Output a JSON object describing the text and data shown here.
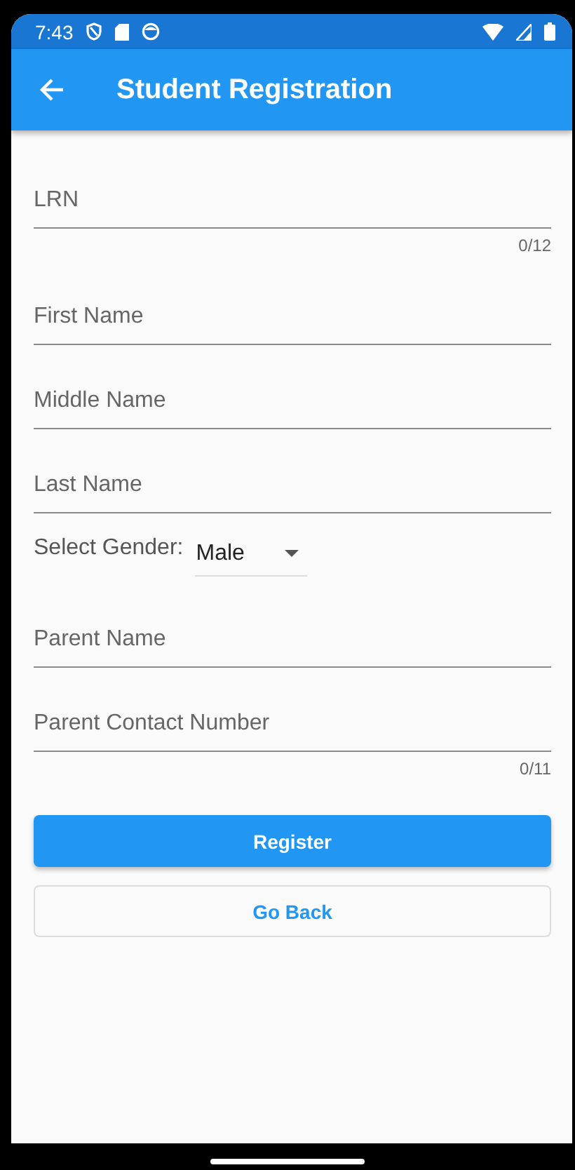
{
  "status_bar": {
    "time": "7:43"
  },
  "app_bar": {
    "title": "Student Registration"
  },
  "form": [
    {
      "kind": "text",
      "placeholder": "LRN",
      "counter": "0/12"
    },
    {
      "kind": "text",
      "placeholder": "First Name"
    },
    {
      "kind": "text",
      "placeholder": "Middle Name"
    },
    {
      "kind": "text",
      "placeholder": "Last Name"
    },
    {
      "kind": "dropdown",
      "label": "Select Gender:",
      "value": "Male"
    },
    {
      "kind": "text",
      "placeholder": "Parent Name"
    },
    {
      "kind": "text",
      "placeholder": "Parent Contact Number",
      "counter": "0/11"
    }
  ],
  "buttons": [
    {
      "kind": "filled",
      "label": "Register"
    },
    {
      "kind": "outlined",
      "label": "Go Back"
    }
  ]
}
